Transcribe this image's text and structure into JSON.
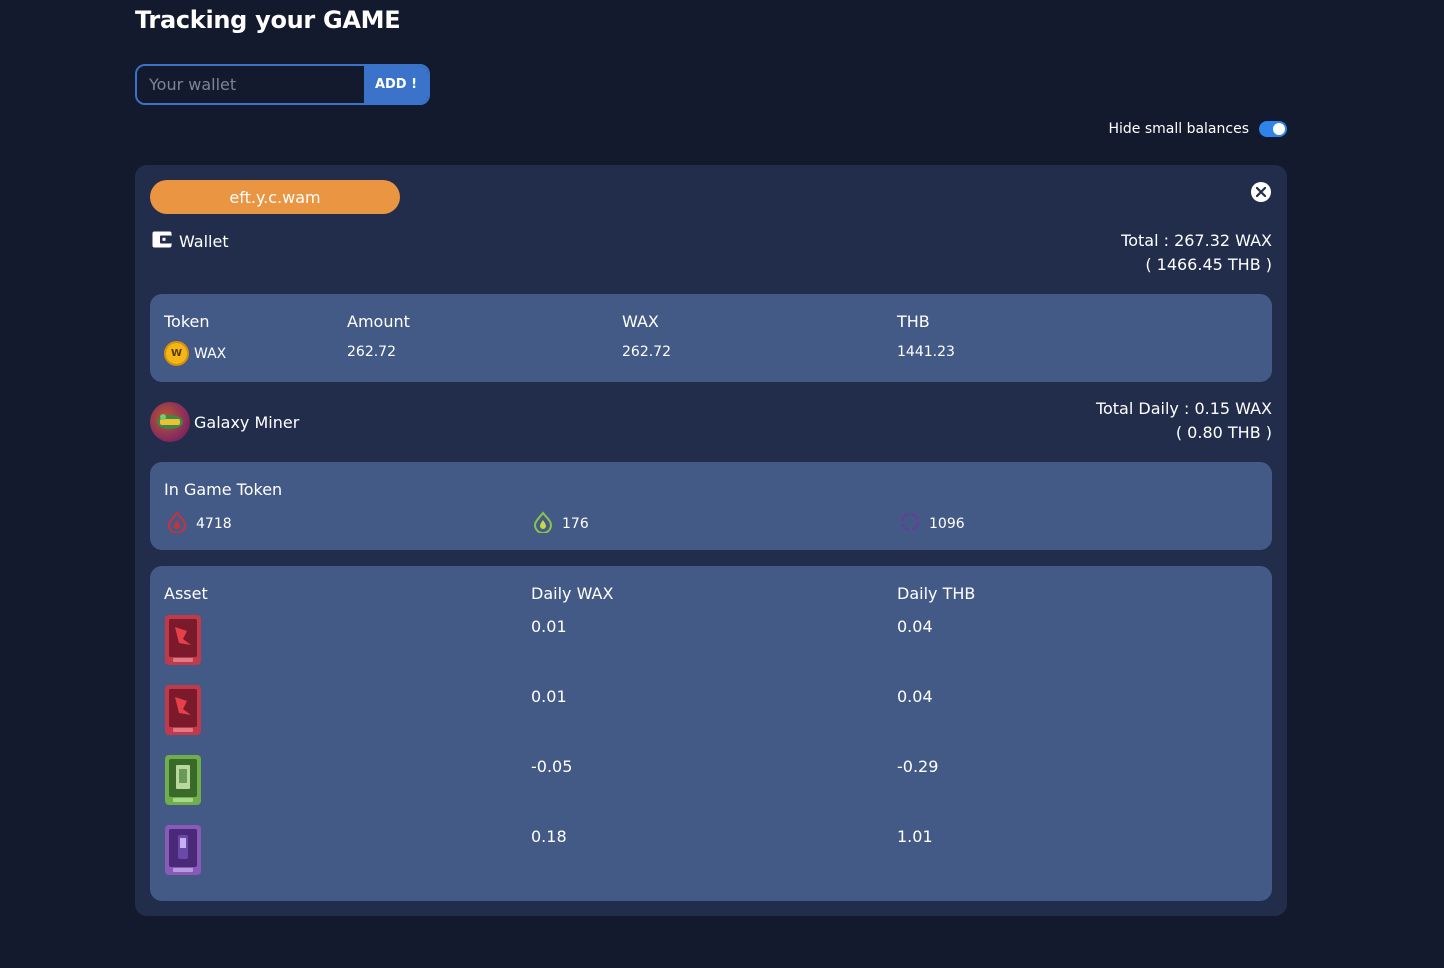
{
  "page": {
    "title": "Tracking your GAME"
  },
  "wallet_form": {
    "placeholder": "Your wallet",
    "add_label": "ADD !"
  },
  "toggle": {
    "label": "Hide small balances",
    "on": true
  },
  "account": {
    "name": "eft.y.c.wam",
    "wallet_label": "Wallet",
    "total_wax": "Total : 267.32 WAX",
    "total_thb": "( 1466.45 THB )",
    "token_table": {
      "headers": [
        "Token",
        "Amount",
        "WAX",
        "THB"
      ],
      "rows": [
        {
          "token": "WAX",
          "icon": "wax-coin-icon",
          "amount": "262.72",
          "wax": "262.72",
          "thb": "1441.23"
        }
      ]
    },
    "game": {
      "name": "Galaxy Miner",
      "total_daily_wax": "Total Daily : 0.15 WAX",
      "total_daily_thb": "( 0.80 THB )",
      "in_game_token": {
        "title": "In Game Token",
        "tokens": [
          {
            "icon": "red-flame-icon",
            "value": "4718",
            "color": "#c8323c"
          },
          {
            "icon": "green-flame-icon",
            "value": "176",
            "color": "#8bc34a"
          },
          {
            "icon": "purple-ring-icon",
            "value": "1096",
            "color": "#6a3a9a"
          }
        ]
      },
      "assets": {
        "headers": [
          "Asset",
          "Daily WAX",
          "Daily THB"
        ],
        "rows": [
          {
            "card": "red-card-icon",
            "daily_wax": "0.01",
            "daily_thb": "0.04"
          },
          {
            "card": "red-card-icon",
            "daily_wax": "0.01",
            "daily_thb": "0.04"
          },
          {
            "card": "green-card-icon",
            "daily_wax": "-0.05",
            "daily_thb": "-0.29"
          },
          {
            "card": "purple-card-icon",
            "daily_wax": "0.18",
            "daily_thb": "1.01"
          }
        ]
      }
    }
  },
  "colors": {
    "background": "#141a2e",
    "card": "#212d4b",
    "panel": "#445a86",
    "accent_blue": "#3a73c9",
    "account_pill": "#ea9541"
  }
}
